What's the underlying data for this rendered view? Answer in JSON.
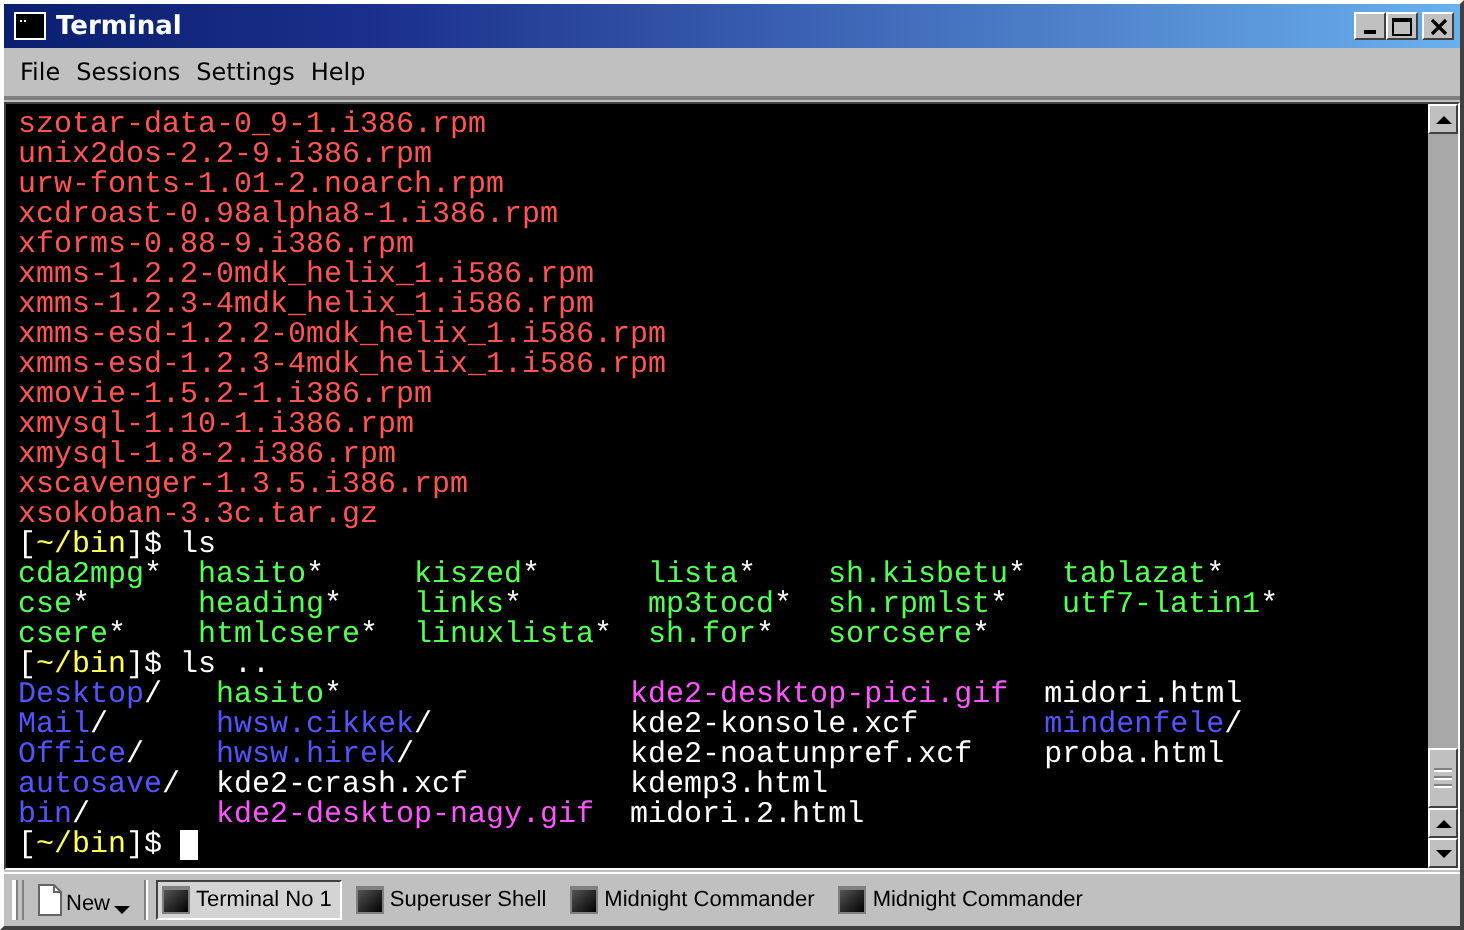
{
  "window": {
    "title": "Terminal"
  },
  "menu": [
    "File",
    "Sessions",
    "Settings",
    "Help"
  ],
  "terminal": {
    "lines": [
      {
        "kind": "output",
        "text": "szotar-data-0_9-1.i386.rpm"
      },
      {
        "kind": "output",
        "text": "unix2dos-2.2-9.i386.rpm"
      },
      {
        "kind": "output",
        "text": "urw-fonts-1.01-2.noarch.rpm"
      },
      {
        "kind": "output",
        "text": "xcdroast-0.98alpha8-1.i386.rpm"
      },
      {
        "kind": "output",
        "text": "xforms-0.88-9.i386.rpm"
      },
      {
        "kind": "output",
        "text": "xmms-1.2.2-0mdk_helix_1.i586.rpm"
      },
      {
        "kind": "output",
        "text": "xmms-1.2.3-4mdk_helix_1.i586.rpm"
      },
      {
        "kind": "output",
        "text": "xmms-esd-1.2.2-0mdk_helix_1.i586.rpm"
      },
      {
        "kind": "output",
        "text": "xmms-esd-1.2.3-4mdk_helix_1.i586.rpm"
      },
      {
        "kind": "output",
        "text": "xmovie-1.5.2-1.i386.rpm"
      },
      {
        "kind": "output",
        "text": "xmysql-1.10-1.i386.rpm"
      },
      {
        "kind": "output",
        "text": "xmysql-1.8-2.i386.rpm"
      },
      {
        "kind": "output",
        "text": "xscavenger-1.3.5.i386.rpm"
      },
      {
        "kind": "output",
        "text": "xsokoban-3.3c.tar.gz"
      },
      {
        "kind": "prompt",
        "parts": [
          {
            "text": "[",
            "kind": "plain"
          },
          {
            "text": "~/bin",
            "kind": "path"
          },
          {
            "text": "]$ ls",
            "kind": "plain"
          }
        ]
      },
      {
        "kind": "listing",
        "columns": [
          [
            {
              "name": "cda2mpg",
              "kind": "exec",
              "suffix": "*"
            },
            {
              "name": "cse",
              "kind": "exec",
              "suffix": "*"
            },
            {
              "name": "csere",
              "kind": "exec",
              "suffix": "*"
            }
          ],
          [
            {
              "name": "hasito",
              "kind": "exec",
              "suffix": "*"
            },
            {
              "name": "heading",
              "kind": "exec",
              "suffix": "*"
            },
            {
              "name": "htmlcsere",
              "kind": "exec",
              "suffix": "*"
            }
          ],
          [
            {
              "name": "kiszed",
              "kind": "exec",
              "suffix": "*"
            },
            {
              "name": "links",
              "kind": "exec",
              "suffix": "*"
            },
            {
              "name": "linuxlista",
              "kind": "exec",
              "suffix": "*"
            }
          ],
          [
            {
              "name": "lista",
              "kind": "exec",
              "suffix": "*"
            },
            {
              "name": "mp3tocd",
              "kind": "exec",
              "suffix": "*"
            },
            {
              "name": "sh.for",
              "kind": "exec",
              "suffix": "*"
            }
          ],
          [
            {
              "name": "sh.kisbetu",
              "kind": "exec",
              "suffix": "*"
            },
            {
              "name": "sh.rpmlst",
              "kind": "exec",
              "suffix": "*"
            },
            {
              "name": "sorcsere",
              "kind": "exec",
              "suffix": "*"
            }
          ],
          [
            {
              "name": "tablazat",
              "kind": "exec",
              "suffix": "*"
            },
            {
              "name": "utf7-latin1",
              "kind": "exec",
              "suffix": "*"
            }
          ]
        ]
      },
      {
        "kind": "prompt",
        "parts": [
          {
            "text": "[",
            "kind": "plain"
          },
          {
            "text": "~/bin",
            "kind": "path"
          },
          {
            "text": "]$ ls ..",
            "kind": "plain"
          }
        ]
      },
      {
        "kind": "listing",
        "columns": [
          [
            {
              "name": "Desktop",
              "kind": "dir",
              "suffix": "/"
            },
            {
              "name": "Mail",
              "kind": "dir",
              "suffix": "/"
            },
            {
              "name": "Office",
              "kind": "dir",
              "suffix": "/"
            },
            {
              "name": "autosave",
              "kind": "dir",
              "suffix": "/"
            },
            {
              "name": "bin",
              "kind": "dir",
              "suffix": "/"
            }
          ],
          [
            {
              "name": "hasito",
              "kind": "exec",
              "suffix": "*"
            },
            {
              "name": "hwsw.cikkek",
              "kind": "dir",
              "suffix": "/"
            },
            {
              "name": "hwsw.hirek",
              "kind": "dir",
              "suffix": "/"
            },
            {
              "name": "kde2-crash.xcf",
              "kind": "file"
            },
            {
              "name": "kde2-desktop-nagy.gif",
              "kind": "image"
            }
          ],
          [
            {
              "name": "kde2-desktop-pici.gif",
              "kind": "image"
            },
            {
              "name": "kde2-konsole.xcf",
              "kind": "file"
            },
            {
              "name": "kde2-noatunpref.xcf",
              "kind": "file"
            },
            {
              "name": "kdemp3.html",
              "kind": "file"
            },
            {
              "name": "midori.2.html",
              "kind": "file"
            }
          ],
          [
            {
              "name": "midori.html",
              "kind": "file"
            },
            {
              "name": "mindenfele",
              "kind": "dir",
              "suffix": "/"
            },
            {
              "name": "proba.html",
              "kind": "file"
            }
          ]
        ]
      },
      {
        "kind": "prompt",
        "parts": [
          {
            "text": "[",
            "kind": "plain"
          },
          {
            "text": "~/bin",
            "kind": "path"
          },
          {
            "text": "]$",
            "kind": "plain"
          }
        ],
        "cursor": true
      }
    ]
  },
  "taskbar": {
    "new_button": "New",
    "tasks": [
      {
        "label": "Terminal No 1",
        "selected": true
      },
      {
        "label": "Superuser Shell",
        "selected": false
      },
      {
        "label": "Midnight Commander",
        "selected": false
      },
      {
        "label": "Midnight Commander",
        "selected": false
      }
    ]
  }
}
